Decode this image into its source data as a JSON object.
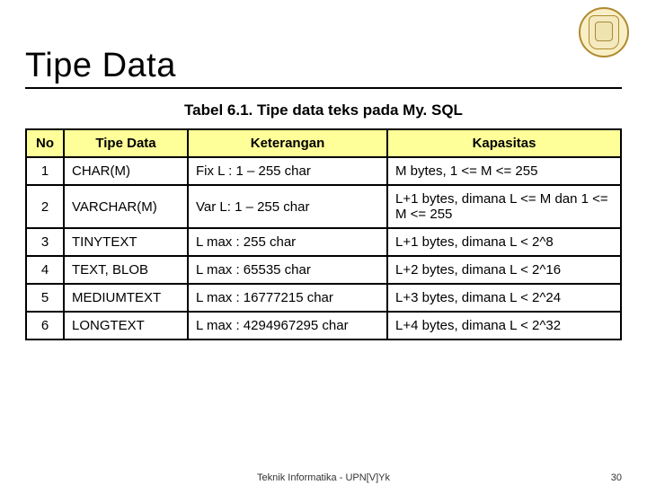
{
  "title": "Tipe Data",
  "caption": "Tabel  6.1. Tipe data teks pada My. SQL",
  "columns": {
    "no": "No",
    "tipe": "Tipe Data",
    "ket": "Keterangan",
    "kap": "Kapasitas"
  },
  "rows": [
    {
      "no": "1",
      "tipe": "CHAR(M)",
      "ket": "Fix L : 1 – 255 char",
      "kap": "M bytes, 1 <= M <= 255"
    },
    {
      "no": "2",
      "tipe": "VARCHAR(M)",
      "ket": "Var L: 1 – 255 char",
      "kap": "L+1 bytes, dimana  L <= M dan  1 <= M <= 255"
    },
    {
      "no": "3",
      "tipe": "TINYTEXT",
      "ket": "L max : 255 char",
      "kap": "L+1 bytes, dimana L < 2^8"
    },
    {
      "no": "4",
      "tipe": "TEXT, BLOB",
      "ket": "L max : 65535 char",
      "kap": "L+2 bytes, dimana L < 2^16"
    },
    {
      "no": "5",
      "tipe": "MEDIUMTEXT",
      "ket": "L max : 16777215 char",
      "kap": "L+3 bytes, dimana L < 2^24"
    },
    {
      "no": "6",
      "tipe": "LONGTEXT",
      "ket": "L max : 4294967295 char",
      "kap": "L+4 bytes, dimana L < 2^32"
    }
  ],
  "footer": {
    "source": "Teknik Informatika - UPN[V]Yk",
    "page": "30"
  }
}
